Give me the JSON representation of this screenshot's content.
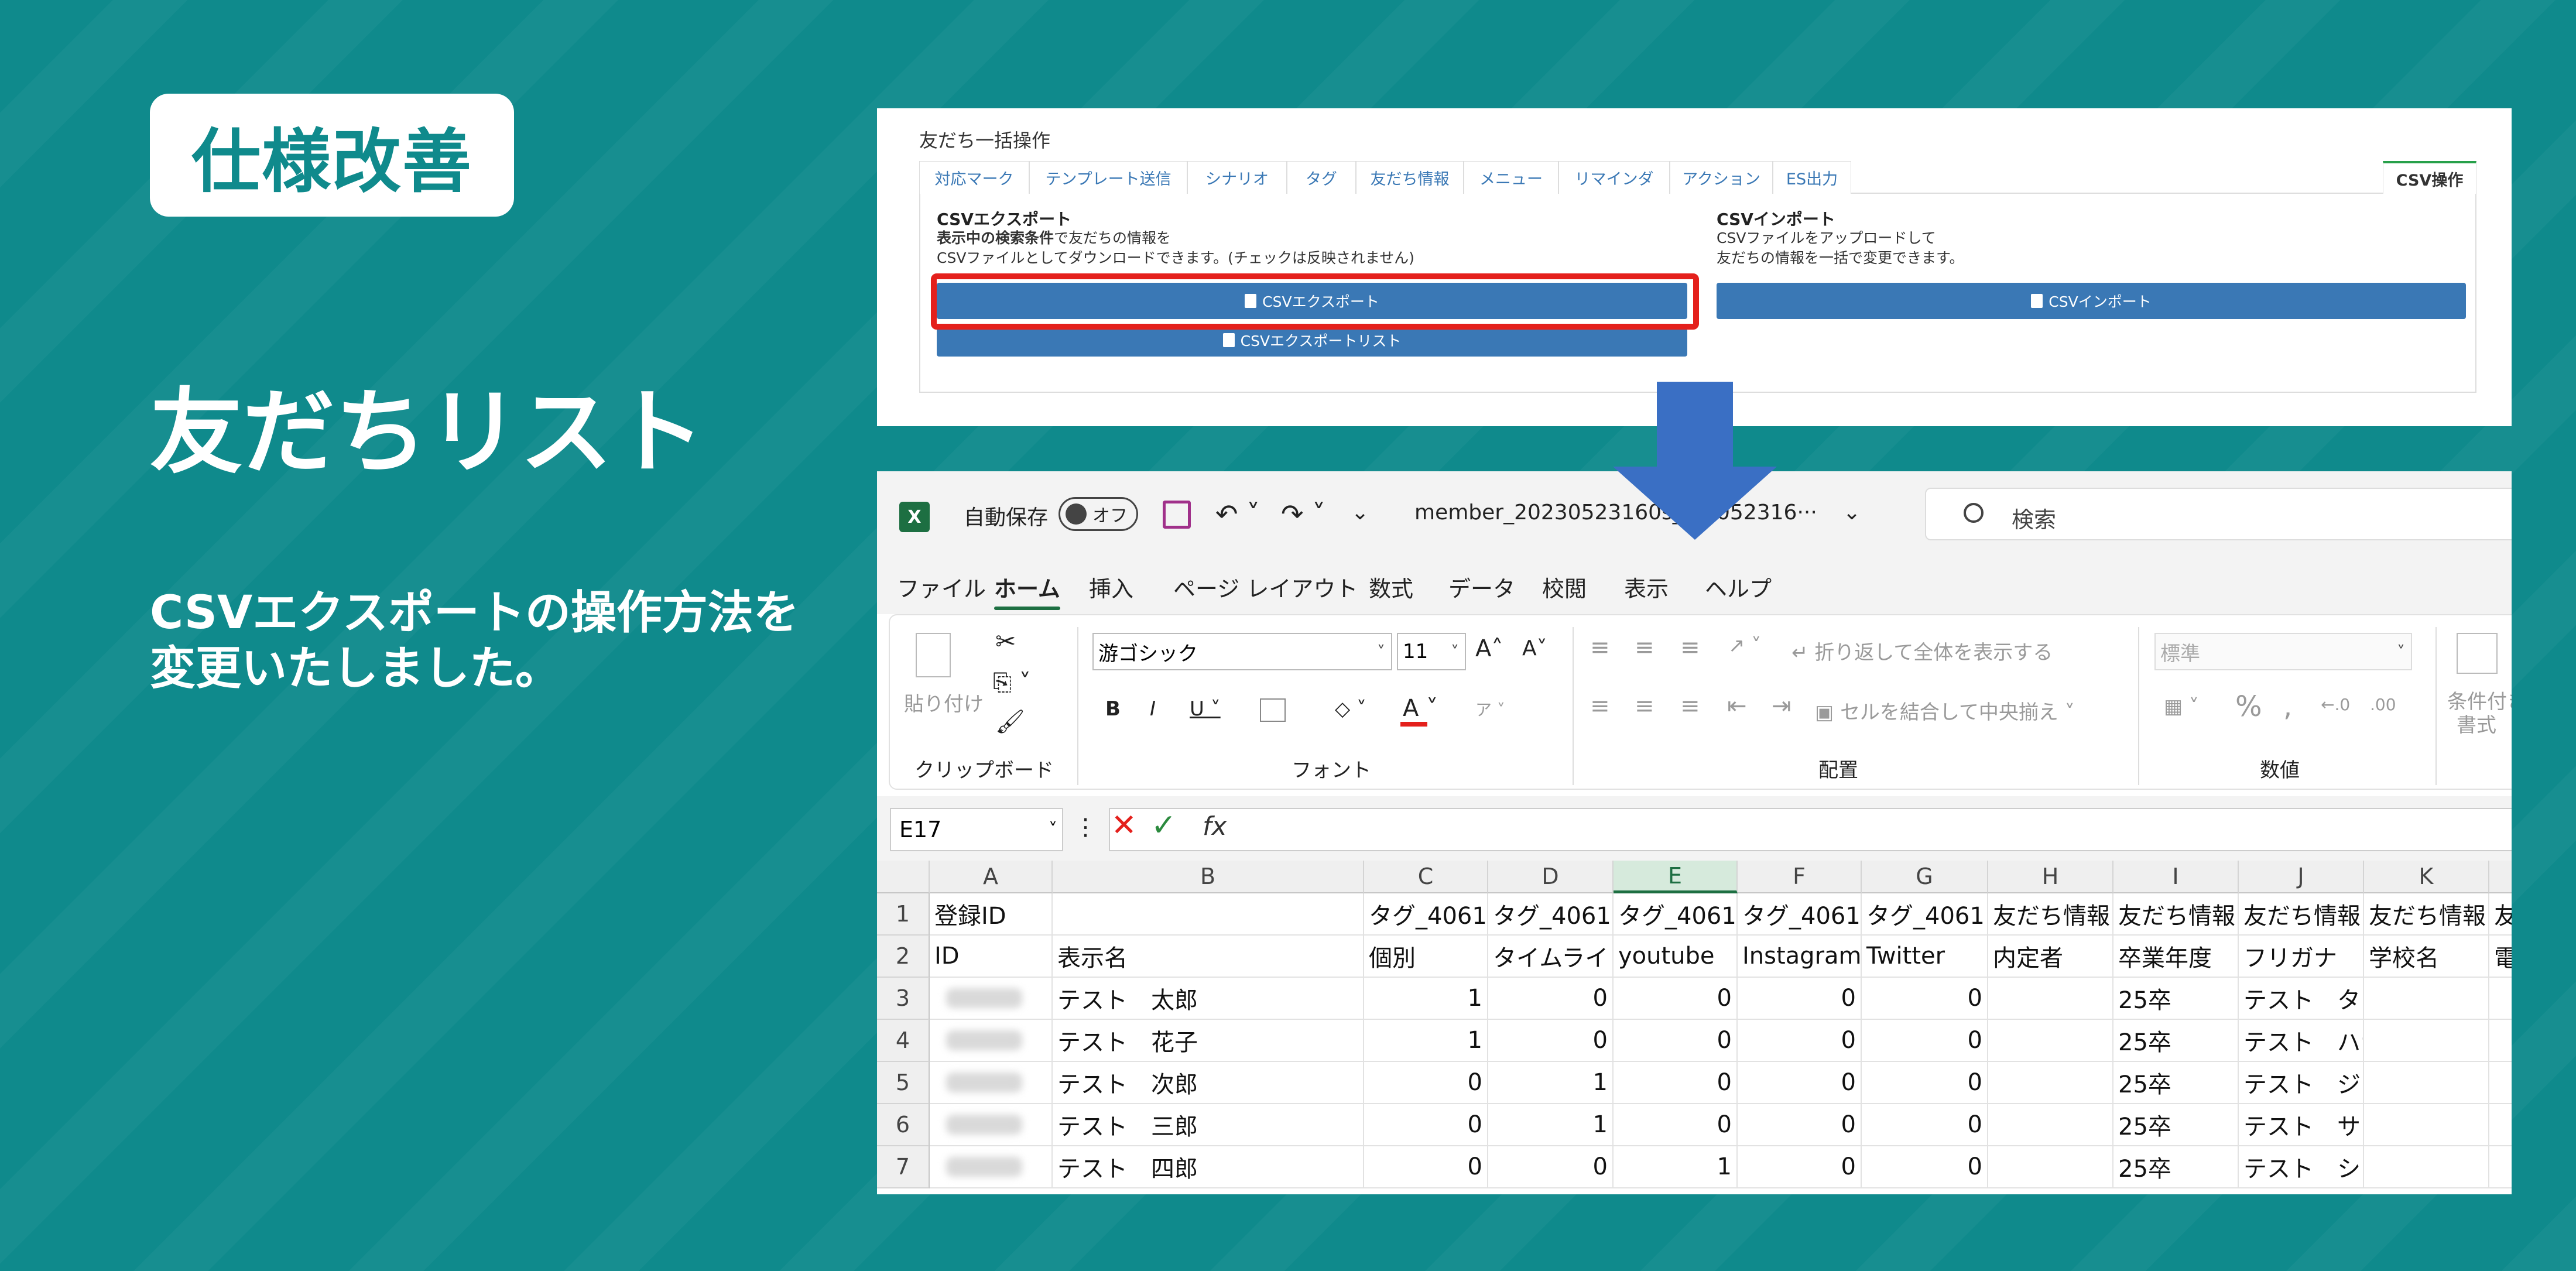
{
  "badge": "仕様改善",
  "title": "友だちリスト",
  "description": [
    "CSVエクスポートの操作方法を",
    "変更いたしました。"
  ],
  "panel": {
    "title": "友だち一括操作",
    "tabs": [
      "対応マーク",
      "テンプレート送信",
      "シナリオ",
      "タグ",
      "友だち情報",
      "メニュー",
      "リマインダ",
      "アクション",
      "ES出力",
      "CSV操作"
    ],
    "export": {
      "title": "CSVエクスポート",
      "line1_bold": "表示中の検索条件",
      "line1_rest": "で友だちの情報を",
      "line2": "CSVファイルとしてダウンロードできます。(チェックは反映されません)",
      "button": "CSVエクスポート",
      "button2": "CSVエクスポートリスト"
    },
    "import": {
      "title": "CSVインポート",
      "line1": "CSVファイルをアップロードして",
      "line2": "友だちの情報を一括で変更できます。",
      "button": "CSVインポート"
    }
  },
  "excel": {
    "autosave": "自動保存",
    "toggle": "オフ",
    "filename": "member_20230523160s_...5052316···",
    "search_placeholder": "検索",
    "menus": [
      "ファイル",
      "ホーム",
      "挿入",
      "ページ レイアウト",
      "数式",
      "データ",
      "校閲",
      "表示",
      "ヘルプ"
    ],
    "ribbon": {
      "paste": "貼り付け",
      "clipboard": "クリップボード",
      "font_name": "游ゴシック",
      "font_size": "11",
      "font_group": "フォント",
      "wrap_text": "折り返して全体を表示する",
      "merge": "セルを結合して中央揃え",
      "align_group": "配置",
      "number_format": "標準",
      "number_group": "数値",
      "conditional": "条件付き",
      "conditional2": "書式"
    },
    "name_box": "E17",
    "columns": [
      "A",
      "B",
      "C",
      "D",
      "E",
      "F",
      "G",
      "H",
      "I",
      "J",
      "K"
    ],
    "rows": [
      {
        "n": "1",
        "cells": [
          "登録ID",
          "",
          "タグ_4061",
          "タグ_4061",
          "タグ_4061",
          "タグ_4061",
          "タグ_4061",
          "友だち情報",
          "友だち情報",
          "友だち情報",
          "友だち情報",
          "友"
        ]
      },
      {
        "n": "2",
        "cells": [
          "ID",
          "表示名",
          "個別",
          "タイムライ",
          "youtube",
          "Instagram",
          "Twitter",
          "内定者",
          "卒業年度",
          "フリガナ",
          "学校名",
          "電"
        ]
      },
      {
        "n": "3",
        "cells": [
          "",
          "テスト　太郎",
          "1",
          "0",
          "0",
          "0",
          "0",
          "",
          "25卒",
          "テスト　タロウ",
          "",
          ""
        ]
      },
      {
        "n": "4",
        "cells": [
          "",
          "テスト　花子",
          "1",
          "0",
          "0",
          "0",
          "0",
          "",
          "25卒",
          "テスト　ハナコ",
          "",
          ""
        ]
      },
      {
        "n": "5",
        "cells": [
          "",
          "テスト　次郎",
          "0",
          "1",
          "0",
          "0",
          "0",
          "",
          "25卒",
          "テスト　ジロウ",
          "",
          ""
        ]
      },
      {
        "n": "6",
        "cells": [
          "",
          "テスト　三郎",
          "0",
          "1",
          "0",
          "0",
          "0",
          "",
          "25卒",
          "テスト　サブロウ",
          "",
          ""
        ]
      },
      {
        "n": "7",
        "cells": [
          "",
          "テスト　四郎",
          "0",
          "0",
          "1",
          "0",
          "0",
          "",
          "25卒",
          "テスト　シロウ",
          "",
          ""
        ]
      }
    ]
  }
}
